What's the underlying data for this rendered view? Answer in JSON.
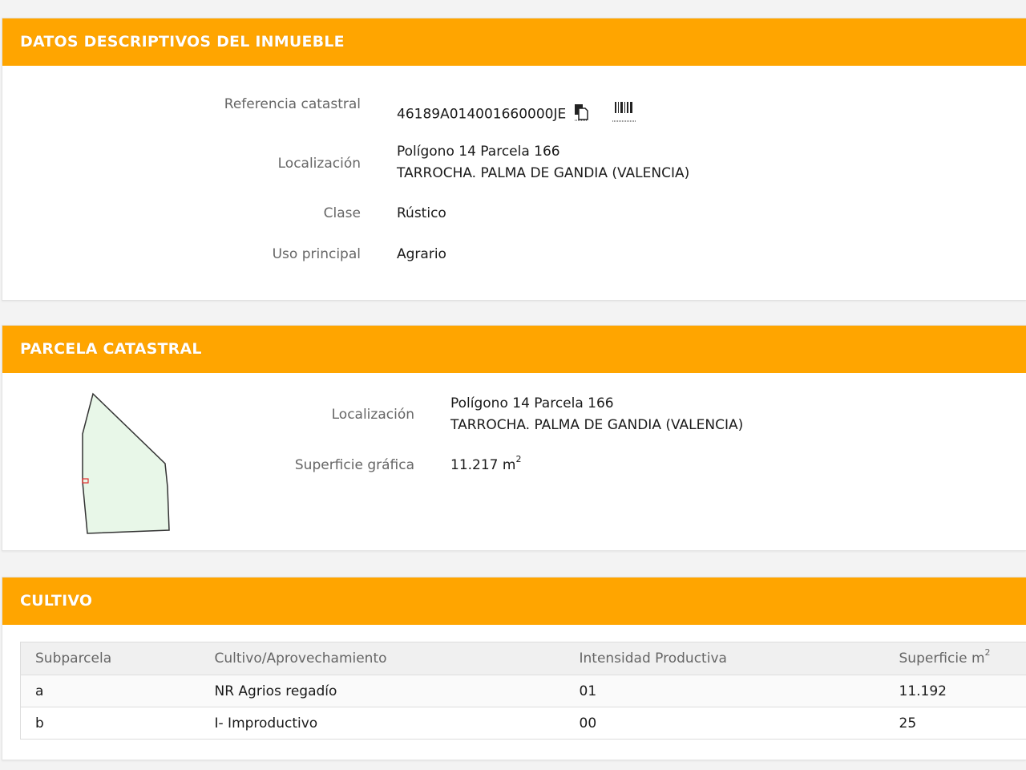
{
  "datos": {
    "title": "DATOS DESCRIPTIVOS DEL INMUEBLE",
    "ref_label": "Referencia catastral",
    "ref_value": "46189A014001660000JE",
    "loc_label": "Localización",
    "loc_line1": "Polígono 14 Parcela 166",
    "loc_line2": "TARROCHA. PALMA DE GANDIA (VALENCIA)",
    "clase_label": "Clase",
    "clase_value": "Rústico",
    "uso_label": "Uso principal",
    "uso_value": "Agrario"
  },
  "parcela": {
    "title": "PARCELA CATASTRAL",
    "loc_label": "Localización",
    "loc_line1": "Polígono 14 Parcela 166",
    "loc_line2": "TARROCHA. PALMA DE GANDIA (VALENCIA)",
    "sup_label": "Superficie gráfica",
    "sup_value": "11.217 m",
    "sup_exp": "2"
  },
  "cultivo": {
    "title": "CULTIVO",
    "headers": [
      "Subparcela",
      "Cultivo/Aprovechamiento",
      "Intensidad Productiva",
      "Superficie m"
    ],
    "header_exp": "2",
    "rows": [
      [
        "a",
        "NR Agrios regadío",
        "01",
        "11.192"
      ],
      [
        "b",
        "I- Improductivo",
        "00",
        "25"
      ]
    ]
  },
  "colors": {
    "header_bg": "#ffa500",
    "parcel_fill": "#e8f7e8"
  },
  "icons": [
    "copy-icon",
    "barcode-icon"
  ]
}
